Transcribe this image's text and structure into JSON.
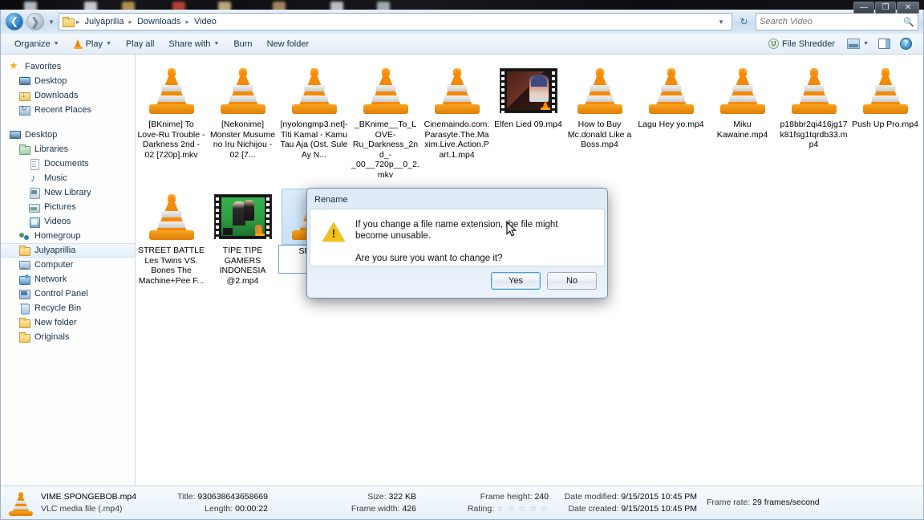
{
  "window": {
    "controls": {
      "minimize": "—",
      "maximize": "❐",
      "close": "✕"
    }
  },
  "addressbar": {
    "back_icon": "back-arrow",
    "forward_icon": "forward-arrow",
    "history_caret": "▼",
    "breadcrumbs": [
      "Julyaprilia",
      "Downloads",
      "Video"
    ],
    "separator": "▸",
    "dropdown_caret": "▼",
    "refresh_icon": "↻",
    "search_placeholder": "Search Video",
    "search_value": "",
    "search_icon": "search-icon"
  },
  "commandbar": {
    "items": [
      {
        "label": "Organize",
        "caret": "▼",
        "icon": ""
      },
      {
        "label": "Play",
        "caret": "▼",
        "icon": "vlc-cone-icon"
      },
      {
        "label": "Play all",
        "caret": "",
        "icon": ""
      },
      {
        "label": "Share with",
        "caret": "▼",
        "icon": ""
      },
      {
        "label": "Burn",
        "caret": "",
        "icon": ""
      },
      {
        "label": "New folder",
        "caret": "",
        "icon": ""
      }
    ],
    "file_shredder": "File Shredder",
    "shredder_glyph": "U",
    "view_caret": "▼",
    "help_glyph": "?"
  },
  "sidebar": {
    "items": [
      {
        "label": "Favorites",
        "icon": "star-icon",
        "indent": 0,
        "selected": false
      },
      {
        "label": "Desktop",
        "icon": "monitor-icon",
        "indent": 1,
        "selected": false
      },
      {
        "label": "Downloads",
        "icon": "download-icon",
        "indent": 1,
        "selected": false
      },
      {
        "label": "Recent Places",
        "icon": "recent-icon",
        "indent": 1,
        "selected": false
      },
      {
        "label": "__GAP__",
        "icon": "",
        "indent": 0,
        "selected": false
      },
      {
        "label": "Desktop",
        "icon": "monitor-icon",
        "indent": 0,
        "selected": false
      },
      {
        "label": "Libraries",
        "icon": "library-icon",
        "indent": 1,
        "selected": false
      },
      {
        "label": "Documents",
        "icon": "document-icon",
        "indent": 2,
        "selected": false
      },
      {
        "label": "Music",
        "icon": "music-note-icon",
        "indent": 2,
        "selected": false
      },
      {
        "label": "New Library",
        "icon": "new-library-icon",
        "indent": 2,
        "selected": false
      },
      {
        "label": "Pictures",
        "icon": "pictures-icon",
        "indent": 2,
        "selected": false
      },
      {
        "label": "Videos",
        "icon": "videos-icon",
        "indent": 2,
        "selected": false
      },
      {
        "label": "Homegroup",
        "icon": "homegroup-icon",
        "indent": 1,
        "selected": false
      },
      {
        "label": "Julyaprillia",
        "icon": "folder-icon",
        "indent": 1,
        "selected": true
      },
      {
        "label": "Computer",
        "icon": "computer-icon",
        "indent": 1,
        "selected": false
      },
      {
        "label": "Network",
        "icon": "network-icon",
        "indent": 1,
        "selected": false
      },
      {
        "label": "Control Panel",
        "icon": "control-panel-icon",
        "indent": 1,
        "selected": false
      },
      {
        "label": "Recycle Bin",
        "icon": "recycle-bin-icon",
        "indent": 1,
        "selected": false
      },
      {
        "label": "New folder",
        "icon": "folder-icon",
        "indent": 1,
        "selected": false
      },
      {
        "label": "Originals",
        "icon": "folder-icon",
        "indent": 1,
        "selected": false
      }
    ]
  },
  "files": {
    "row1": [
      {
        "name": "[BKnime] To Love-Ru Trouble - Darkness 2nd - 02 [720p].mkv",
        "icon": "vlc-cone-icon",
        "selected": false
      },
      {
        "name": "[Nekonime] Monster Musume no Iru Nichijou - 02 [7...",
        "icon": "vlc-cone-icon",
        "selected": false
      },
      {
        "name": "[nyolongmp3.net]-Titi Kamal - Kamu Tau Aja (Ost. Sule Ay N...",
        "icon": "vlc-cone-icon",
        "selected": false
      },
      {
        "name": "_BKnime__To_LOVE-Ru_Darkness_2nd_-_00__720p__0_2.mkv",
        "icon": "vlc-cone-icon",
        "selected": false
      },
      {
        "name": "Cinemaindo.com.Parasyte.The.Maxim.Live.Action.Part.1.mp4",
        "icon": "vlc-cone-icon",
        "selected": false
      },
      {
        "name": "Elfen Lied 09.mp4",
        "icon": "video-thumbnail",
        "selected": false,
        "thumb": "elfen"
      },
      {
        "name": "How to Buy Mc.donald Like a Boss.mp4",
        "icon": "vlc-cone-icon",
        "selected": false
      },
      {
        "name": "Lagu Hey yo.mp4",
        "icon": "vlc-cone-icon",
        "selected": false
      },
      {
        "name": "Miku Kawaine.mp4",
        "icon": "vlc-cone-icon",
        "selected": false
      },
      {
        "name": "p18bbr2qi416jg17k81fsg1tqrdb33.mp4",
        "icon": "vlc-cone-icon",
        "selected": false
      },
      {
        "name": "Push Up Pro.mp4",
        "icon": "vlc-cone-icon",
        "selected": false
      }
    ],
    "row2": [
      {
        "name": "STREET BATTLE Les Twins VS. Bones The Machine+Pee F...",
        "icon": "vlc-cone-icon",
        "selected": false
      },
      {
        "name": "TIPE TIPE GAMERS INDONESIA @2.mp4",
        "icon": "video-thumbnail",
        "selected": false,
        "thumb": "gamers"
      },
      {
        "name": "SPONG",
        "icon": "vlc-cone-icon",
        "selected": true,
        "renaming": true
      }
    ]
  },
  "dialog": {
    "title": "Rename",
    "icon": "warning-icon",
    "message_line1": "If you change a file name extension, the file might become unusable.",
    "message_line2": "Are you sure you want to change it?",
    "yes_label": "Yes",
    "no_label": "No"
  },
  "details": {
    "filename": "VIME SPONGEBOB.mp4",
    "filetype": "VLC media file (.mp4)",
    "title_key": "Title:",
    "title_value": "930638643658669",
    "length_key": "Length:",
    "length_value": "00:00:22",
    "size_key": "Size:",
    "size_value": "322 KB",
    "framewidth_key": "Frame width:",
    "framewidth_value": "426",
    "frameheight_key": "Frame height:",
    "frameheight_value": "240",
    "rating_key": "Rating:",
    "rating_value": "☆ ☆ ☆ ☆ ☆",
    "datemodified_key": "Date modified:",
    "datemodified_value": "9/15/2015 10:45 PM",
    "datecreated_key": "Date created:",
    "datecreated_value": "9/15/2015 10:45 PM",
    "framerate_key": "Frame rate:",
    "framerate_value": "29 frames/second"
  },
  "colors": {
    "accent": "#2b82c8",
    "vlc_orange": "#f58a07",
    "selection": "#cde8ff",
    "warning_yellow": "#f2c219"
  }
}
